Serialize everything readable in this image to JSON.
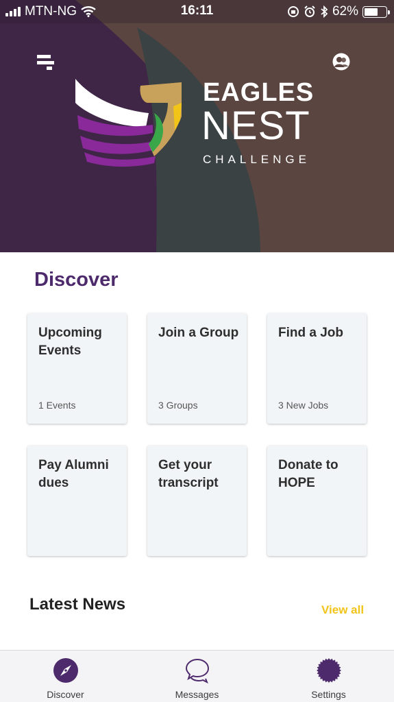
{
  "status_bar": {
    "carrier": "MTN-NG",
    "time": "16:11",
    "battery": "62%",
    "battery_level": 0.62
  },
  "header": {
    "brand_line1": "EAGLES",
    "brand_line2": "NEST",
    "brand_line3": "CHALLENGE"
  },
  "discover": {
    "title": "Discover",
    "cards": [
      {
        "title": "Upcoming Events",
        "subtitle": "1 Events"
      },
      {
        "title": "Join a Group",
        "subtitle": "3 Groups"
      },
      {
        "title": "Find a Job",
        "subtitle": "3 New Jobs"
      },
      {
        "title": "Pay Alumni dues",
        "subtitle": ""
      },
      {
        "title": "Get your transcript",
        "subtitle": ""
      },
      {
        "title": "Donate to HOPE",
        "subtitle": ""
      }
    ]
  },
  "news": {
    "title": "Latest News",
    "view_all": "View all"
  },
  "tabbar": {
    "tabs": [
      {
        "label": "Discover",
        "icon": "compass-icon"
      },
      {
        "label": "Messages",
        "icon": "chat-bubbles-icon"
      },
      {
        "label": "Settings",
        "icon": "gear-icon"
      }
    ]
  },
  "colors": {
    "accent_purple": "#4d2a6b",
    "accent_yellow": "#f2c418",
    "card_bg": "#f2f5f7"
  }
}
